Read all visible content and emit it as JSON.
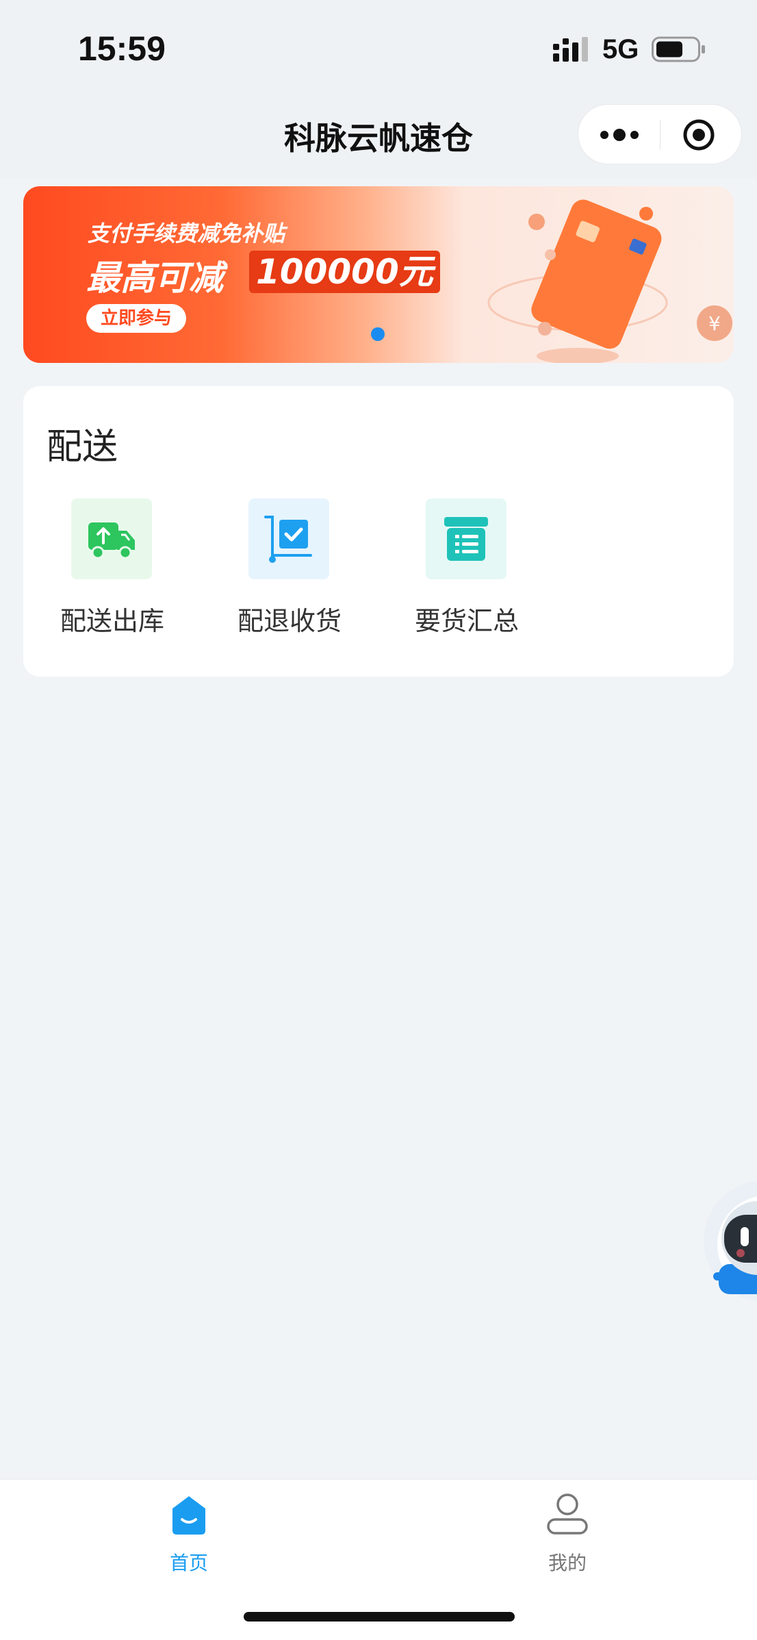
{
  "status_bar": {
    "time": "15:59",
    "network": "5G"
  },
  "nav": {
    "title": "科脉云帆速仓"
  },
  "banner": {
    "line1": "支付手续费减免补贴",
    "line2": "最高可减",
    "amount": "100000元",
    "button_label": "立即参与"
  },
  "delivery": {
    "title": "配送",
    "items": [
      {
        "label": "配送出库",
        "icon": "truck-upload-icon",
        "bg": "#e8f9ec",
        "color": "#2dc55e"
      },
      {
        "label": "配退收货",
        "icon": "cart-check-icon",
        "bg": "#e6f4fe",
        "color": "#1ea0f0"
      },
      {
        "label": "要货汇总",
        "icon": "box-list-icon",
        "bg": "#e5f8f6",
        "color": "#1fc2b8"
      }
    ]
  },
  "tabs": [
    {
      "label": "首页",
      "icon": "home-icon",
      "active": true
    },
    {
      "label": "我的",
      "icon": "user-icon",
      "active": false
    }
  ],
  "colors": {
    "accent": "#1a9df0",
    "banner_orange": "#ff4a20",
    "background": "#f1f4f7"
  }
}
